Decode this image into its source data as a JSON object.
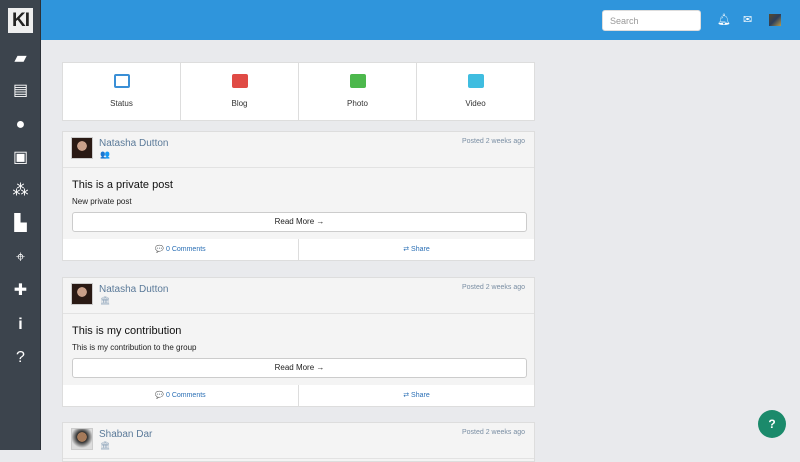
{
  "sidebar": {
    "logo": "KI",
    "items": [
      {
        "name": "book",
        "glyph": "📒"
      },
      {
        "name": "newspaper",
        "glyph": "📰"
      },
      {
        "name": "user",
        "glyph": "👤"
      },
      {
        "name": "tie",
        "glyph": "👔"
      },
      {
        "name": "group",
        "glyph": "👥"
      },
      {
        "name": "factory",
        "glyph": "🏭"
      },
      {
        "name": "crosshairs",
        "glyph": "⌖"
      },
      {
        "name": "user-plus",
        "glyph": "+"
      },
      {
        "name": "info",
        "glyph": "i"
      },
      {
        "name": "help",
        "glyph": "?"
      }
    ]
  },
  "topbar": {
    "search_placeholder": "Search",
    "bell": "🔔",
    "mail": "✉"
  },
  "actions": [
    {
      "label": "Status",
      "color": "#3a8fd6"
    },
    {
      "label": "Blog",
      "color": "#e04b45"
    },
    {
      "label": "Photo",
      "color": "#4cb84c"
    },
    {
      "label": "Video",
      "color": "#3fbde0"
    }
  ],
  "posts": [
    {
      "author": "Natasha Dutton",
      "visibility_icon": "👥",
      "posted": "Posted 2 weeks ago",
      "title": "This is a private post",
      "text": "New private post",
      "read_more": "Read More →",
      "comments": "💬 0 Comments",
      "share": "⇄ Share"
    },
    {
      "author": "Natasha Dutton",
      "visibility_icon": "🏛",
      "posted": "Posted 2 weeks ago",
      "title": "This is my contribution",
      "text": "This is my contribution to the group",
      "read_more": "Read More →",
      "comments": "💬 0 Comments",
      "share": "⇄ Share"
    },
    {
      "author": "Shaban Dar",
      "visibility_icon": "🏛",
      "posted": "Posted 2 weeks ago"
    }
  ],
  "help": "?"
}
